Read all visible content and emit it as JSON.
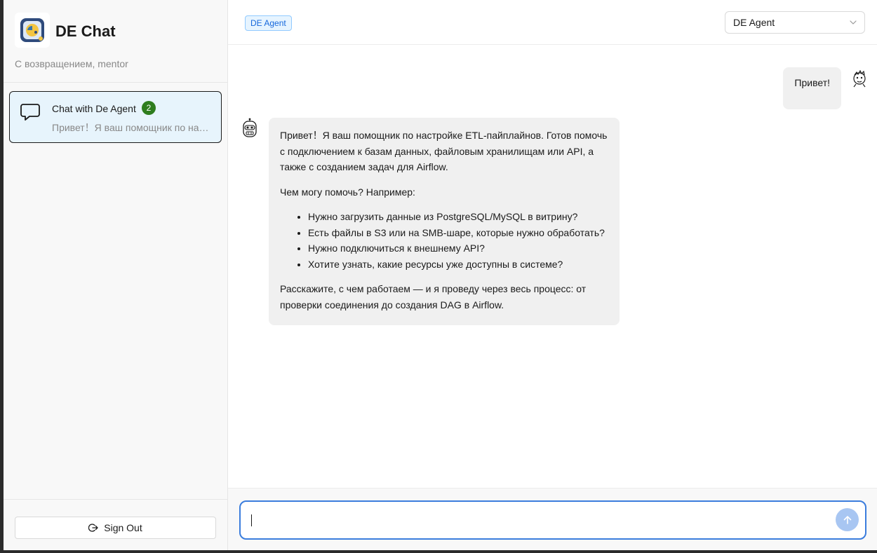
{
  "sidebar": {
    "app_title": "DE Chat",
    "welcome": "С возвращением, mentor",
    "chats": [
      {
        "title": "Chat with De Agent",
        "badge": "2",
        "preview": "Привет！Я ваш помощник по настройке ETL-пайплайнов."
      }
    ],
    "sign_out_label": "Sign Out"
  },
  "header": {
    "agent_tag": "DE Agent",
    "agent_select_value": "DE Agent"
  },
  "messages": {
    "user": {
      "text": "Привет!"
    },
    "bot": {
      "intro": "Привет！Я ваш помощник по настройке ETL-пайплайнов. Готов помочь с подключением к базам данных, файловым хранилищам или API, а также с созданием задач для Airflow.",
      "question": "Чем могу помочь? Например:",
      "items": [
        "Нужно загрузить данные из PostgreSQL/MySQL в витрину?",
        "Есть файлы в S3 или на SMB-шаре, которые нужно обработать?",
        "Нужно подключиться к внешнему API?",
        "Хотите узнать, какие ресурсы уже доступны в системе?"
      ],
      "outro": "Расскажите, с чем работаем — и я проведу через весь процесс: от проверки соединения до создания DAG в Airflow."
    }
  },
  "composer": {
    "value": ""
  },
  "colors": {
    "accent": "#3b7ddd",
    "badge": "#2e7d1e",
    "active_chat_bg": "#e7f4fc",
    "tag_text": "#1668dc"
  }
}
